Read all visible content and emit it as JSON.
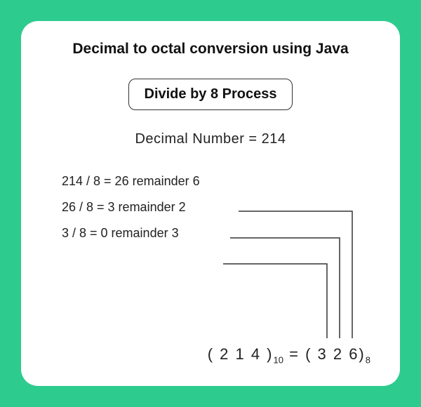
{
  "title": "Decimal to octal conversion using Java",
  "process_label": "Divide by 8 Process",
  "decimal_label": "Decimal Number  =  214",
  "steps": [
    "214 / 8  =  26 remainder 6",
    "26 / 8  =  3 remainder 2",
    "3 / 8  =  0 remainder 3"
  ],
  "result": {
    "decimal_digits": "( 2 1 4 )",
    "decimal_base": "10",
    "equals": " = ",
    "octal_digits": "( 3 2 6)",
    "octal_base": "8"
  },
  "colors": {
    "frame": "#2ecb8f",
    "card": "#ffffff",
    "text": "#222222",
    "line": "#333333"
  },
  "conversion_data": {
    "decimal_value": 214,
    "base": 8,
    "divisions": [
      {
        "dividend": 214,
        "quotient": 26,
        "remainder": 6
      },
      {
        "dividend": 26,
        "quotient": 3,
        "remainder": 2
      },
      {
        "dividend": 3,
        "quotient": 0,
        "remainder": 3
      }
    ],
    "octal_result": "326"
  }
}
